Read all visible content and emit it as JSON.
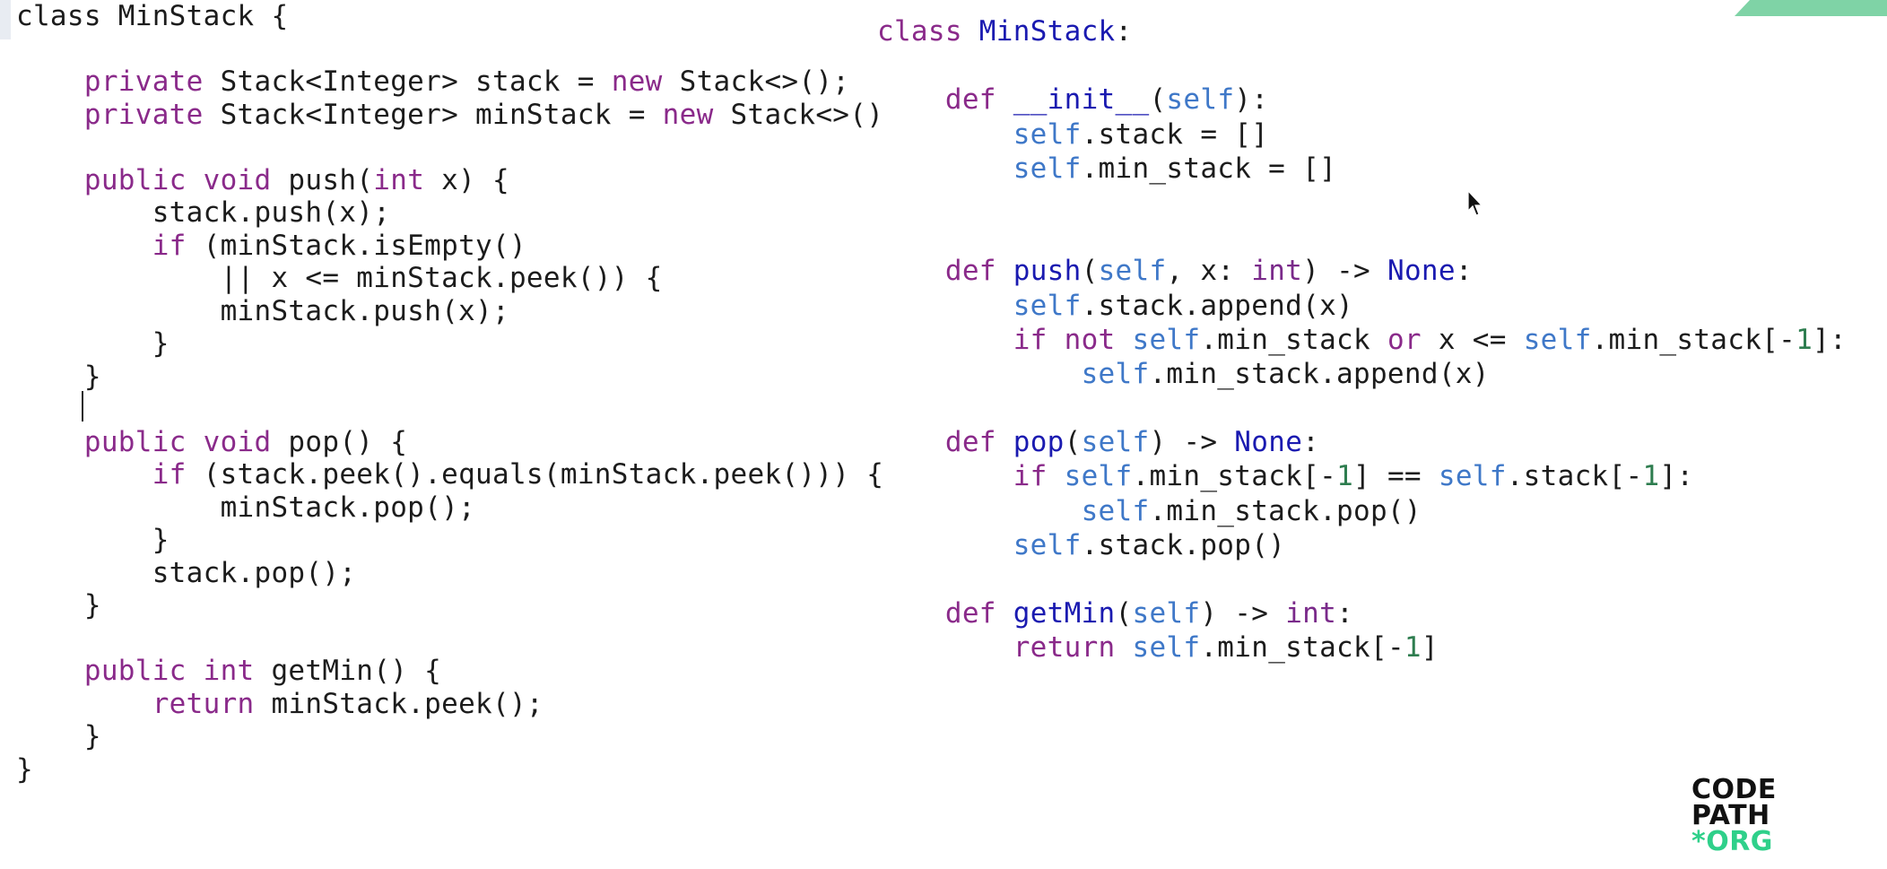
{
  "java_code": {
    "lines": [
      [
        {
          "t": "class MinStack {",
          "c": "plain"
        }
      ],
      [],
      [
        {
          "t": "    ",
          "c": "plain"
        },
        {
          "t": "private",
          "c": "kw"
        },
        {
          "t": " Stack<Integer> stack = ",
          "c": "plain"
        },
        {
          "t": "new",
          "c": "kw"
        },
        {
          "t": " Stack<>();",
          "c": "plain"
        }
      ],
      [
        {
          "t": "    ",
          "c": "plain"
        },
        {
          "t": "private",
          "c": "kw"
        },
        {
          "t": " Stack<Integer> minStack = ",
          "c": "plain"
        },
        {
          "t": "new",
          "c": "kw"
        },
        {
          "t": " Stack<>()",
          "c": "plain"
        }
      ],
      [],
      [
        {
          "t": "    ",
          "c": "plain"
        },
        {
          "t": "public void",
          "c": "kw"
        },
        {
          "t": " push(",
          "c": "plain"
        },
        {
          "t": "int",
          "c": "kw"
        },
        {
          "t": " x) {",
          "c": "plain"
        }
      ],
      [
        {
          "t": "        stack.push(x);",
          "c": "plain"
        }
      ],
      [
        {
          "t": "        ",
          "c": "plain"
        },
        {
          "t": "if",
          "c": "kw"
        },
        {
          "t": " (minStack.isEmpty()",
          "c": "plain"
        }
      ],
      [
        {
          "t": "            || x <= minStack.peek()) {",
          "c": "plain"
        }
      ],
      [
        {
          "t": "            minStack.push(x);",
          "c": "plain"
        }
      ],
      [
        {
          "t": "        }",
          "c": "plain"
        }
      ],
      [
        {
          "t": "    }",
          "c": "plain"
        }
      ],
      [],
      [
        {
          "t": "    ",
          "c": "plain"
        },
        {
          "t": "public void",
          "c": "kw"
        },
        {
          "t": " pop() {",
          "c": "plain"
        }
      ],
      [
        {
          "t": "        ",
          "c": "plain"
        },
        {
          "t": "if",
          "c": "kw"
        },
        {
          "t": " (stack.peek().equals(minStack.peek())) {",
          "c": "plain"
        }
      ],
      [
        {
          "t": "            minStack.pop();",
          "c": "plain"
        }
      ],
      [
        {
          "t": "        }",
          "c": "plain"
        }
      ],
      [
        {
          "t": "        stack.pop();",
          "c": "plain"
        }
      ],
      [
        {
          "t": "    }",
          "c": "plain"
        }
      ],
      [],
      [
        {
          "t": "    ",
          "c": "plain"
        },
        {
          "t": "public int",
          "c": "kw"
        },
        {
          "t": " getMin() {",
          "c": "plain"
        }
      ],
      [
        {
          "t": "        ",
          "c": "plain"
        },
        {
          "t": "return",
          "c": "kw"
        },
        {
          "t": " minStack.peek();",
          "c": "plain"
        }
      ],
      [
        {
          "t": "    }",
          "c": "plain"
        }
      ],
      [
        {
          "t": "}",
          "c": "plain"
        }
      ]
    ]
  },
  "python_code": {
    "lines": [
      [
        {
          "t": "class",
          "c": "kw"
        },
        {
          "t": " ",
          "c": "plain"
        },
        {
          "t": "MinStack",
          "c": "cls"
        },
        {
          "t": ":",
          "c": "plain"
        }
      ],
      [],
      [
        {
          "t": "    ",
          "c": "plain"
        },
        {
          "t": "def",
          "c": "kw"
        },
        {
          "t": " ",
          "c": "plain"
        },
        {
          "t": "__init__",
          "c": "fn"
        },
        {
          "t": "(",
          "c": "plain"
        },
        {
          "t": "self",
          "c": "self"
        },
        {
          "t": "):",
          "c": "plain"
        }
      ],
      [
        {
          "t": "        ",
          "c": "plain"
        },
        {
          "t": "self",
          "c": "self"
        },
        {
          "t": ".stack = []",
          "c": "plain"
        }
      ],
      [
        {
          "t": "        ",
          "c": "plain"
        },
        {
          "t": "self",
          "c": "self"
        },
        {
          "t": ".min_stack = []",
          "c": "plain"
        }
      ],
      [],
      [],
      [
        {
          "t": "    ",
          "c": "plain"
        },
        {
          "t": "def",
          "c": "kw"
        },
        {
          "t": " ",
          "c": "plain"
        },
        {
          "t": "push",
          "c": "fn"
        },
        {
          "t": "(",
          "c": "plain"
        },
        {
          "t": "self",
          "c": "self"
        },
        {
          "t": ", x: ",
          "c": "plain"
        },
        {
          "t": "int",
          "c": "type"
        },
        {
          "t": ") -> ",
          "c": "plain"
        },
        {
          "t": "None",
          "c": "const"
        },
        {
          "t": ":",
          "c": "plain"
        }
      ],
      [
        {
          "t": "        ",
          "c": "plain"
        },
        {
          "t": "self",
          "c": "self"
        },
        {
          "t": ".stack.append(x)",
          "c": "plain"
        }
      ],
      [
        {
          "t": "        ",
          "c": "plain"
        },
        {
          "t": "if not",
          "c": "kw"
        },
        {
          "t": " ",
          "c": "plain"
        },
        {
          "t": "self",
          "c": "self"
        },
        {
          "t": ".min_stack ",
          "c": "plain"
        },
        {
          "t": "or",
          "c": "kw"
        },
        {
          "t": " x <= ",
          "c": "plain"
        },
        {
          "t": "self",
          "c": "self"
        },
        {
          "t": ".min_stack[-",
          "c": "plain"
        },
        {
          "t": "1",
          "c": "num"
        },
        {
          "t": "]:",
          "c": "plain"
        }
      ],
      [
        {
          "t": "            ",
          "c": "plain"
        },
        {
          "t": "self",
          "c": "self"
        },
        {
          "t": ".min_stack.append(x)",
          "c": "plain"
        }
      ],
      [],
      [
        {
          "t": "    ",
          "c": "plain"
        },
        {
          "t": "def",
          "c": "kw"
        },
        {
          "t": " ",
          "c": "plain"
        },
        {
          "t": "pop",
          "c": "fn"
        },
        {
          "t": "(",
          "c": "plain"
        },
        {
          "t": "self",
          "c": "self"
        },
        {
          "t": ") -> ",
          "c": "plain"
        },
        {
          "t": "None",
          "c": "const"
        },
        {
          "t": ":",
          "c": "plain"
        }
      ],
      [
        {
          "t": "        ",
          "c": "plain"
        },
        {
          "t": "if",
          "c": "kw"
        },
        {
          "t": " ",
          "c": "plain"
        },
        {
          "t": "self",
          "c": "self"
        },
        {
          "t": ".min_stack[-",
          "c": "plain"
        },
        {
          "t": "1",
          "c": "num"
        },
        {
          "t": "] == ",
          "c": "plain"
        },
        {
          "t": "self",
          "c": "self"
        },
        {
          "t": ".stack[-",
          "c": "plain"
        },
        {
          "t": "1",
          "c": "num"
        },
        {
          "t": "]:",
          "c": "plain"
        }
      ],
      [
        {
          "t": "            ",
          "c": "plain"
        },
        {
          "t": "self",
          "c": "self"
        },
        {
          "t": ".min_stack.pop()",
          "c": "plain"
        }
      ],
      [
        {
          "t": "        ",
          "c": "plain"
        },
        {
          "t": "self",
          "c": "self"
        },
        {
          "t": ".stack.pop()",
          "c": "plain"
        }
      ],
      [],
      [
        {
          "t": "    ",
          "c": "plain"
        },
        {
          "t": "def",
          "c": "kw"
        },
        {
          "t": " ",
          "c": "plain"
        },
        {
          "t": "getMin",
          "c": "fn"
        },
        {
          "t": "(",
          "c": "plain"
        },
        {
          "t": "self",
          "c": "self"
        },
        {
          "t": ") -> ",
          "c": "plain"
        },
        {
          "t": "int",
          "c": "type"
        },
        {
          "t": ":",
          "c": "plain"
        }
      ],
      [
        {
          "t": "        ",
          "c": "plain"
        },
        {
          "t": "return",
          "c": "kw"
        },
        {
          "t": " ",
          "c": "plain"
        },
        {
          "t": "self",
          "c": "self"
        },
        {
          "t": ".min_stack[-",
          "c": "plain"
        },
        {
          "t": "1",
          "c": "num"
        },
        {
          "t": "]",
          "c": "plain"
        }
      ]
    ]
  },
  "logo": {
    "line1": "CODE",
    "line2": "PATH",
    "line3": "*ORG"
  },
  "icons": {
    "cursor": "mouse-pointer-icon"
  },
  "colors": {
    "keyword": "#8a2a8a",
    "class_name": "#1a1ab0",
    "self": "#3f78c8",
    "number": "#2e7d4f",
    "logo_accent": "#2fd08a",
    "banner": "#7fd3a6"
  }
}
